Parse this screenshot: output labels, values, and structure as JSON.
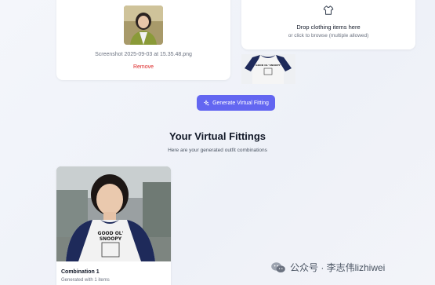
{
  "upload": {
    "filename": "Screenshot 2025-09-03 at 15.35.48.png",
    "remove_label": "Remove"
  },
  "dropzone": {
    "icon": "shirt-icon",
    "title": "Drop clothing items here",
    "subtitle": "or click to browse (multiple allowed)",
    "shirt_text": "GOOD OL' SNOOPY"
  },
  "generate_button": {
    "label": "Generate Virtual Fitting",
    "icon": "sparkle-icon"
  },
  "results": {
    "title": "Your Virtual Fittings",
    "subtitle": "Here are your generated outfit combinations",
    "items": [
      {
        "title": "Combination 1",
        "subtitle": "Generated with 1 items",
        "shirt_text_line1": "GOOD OL'",
        "shirt_text_line2": "SNOOPY"
      }
    ]
  },
  "watermark": {
    "text": "公众号 · 李志伟lizhiwei"
  },
  "colors": {
    "accent": "#6366f1",
    "remove": "#dc2626"
  }
}
